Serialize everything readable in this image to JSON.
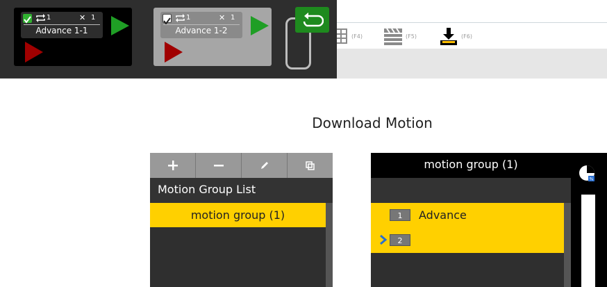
{
  "toolbar": {
    "items": [
      {
        "icon": "table-icon",
        "key": "(F4)"
      },
      {
        "icon": "clapperboard-icon",
        "key": "(F5)"
      },
      {
        "icon": "download-icon",
        "key": "(F6)"
      }
    ]
  },
  "overlay": {
    "cards": [
      {
        "name": "Advance 1-1",
        "repeat": "1",
        "times_icon": "✕",
        "count": "1",
        "checked": true
      },
      {
        "name": "Advance 1-2",
        "repeat": "1",
        "times_icon": "✕",
        "count": "1",
        "checked": true
      }
    ]
  },
  "page": {
    "title": "Download Motion"
  },
  "left_panel": {
    "header": "Motion Group List",
    "items": [
      "motion group (1)"
    ]
  },
  "right_panel": {
    "header": "motion group (1)",
    "rows": [
      {
        "num": "1",
        "name": "Advance"
      },
      {
        "num": "2",
        "name": ""
      }
    ],
    "badge": "%"
  },
  "colors": {
    "accent": "#ffd000",
    "play_green": "#1f9e25",
    "play_red": "#a00000"
  }
}
